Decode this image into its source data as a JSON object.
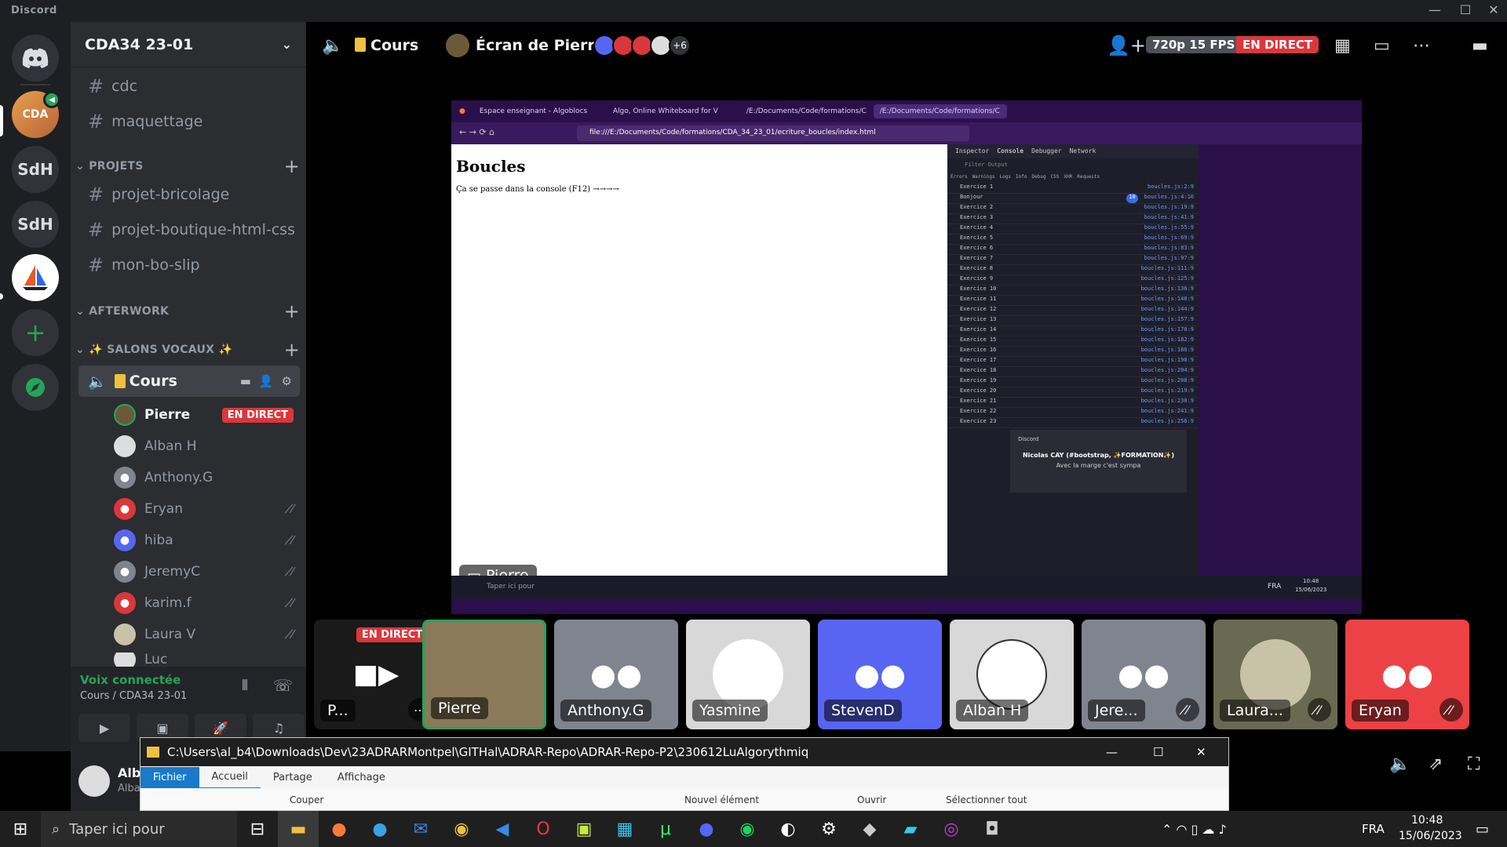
{
  "window": {
    "brand": "Discord"
  },
  "guilds": [
    {
      "label": "SdH"
    },
    {
      "label": "SdH"
    }
  ],
  "server": {
    "name": "CDA34 23-01"
  },
  "channels_top": [
    "cdc",
    "maquettage"
  ],
  "categories": {
    "projets": "PROJETS",
    "afterwork": "AFTERWORK",
    "vocaux": "✨ SALONS VOCAUX ✨"
  },
  "project_channels": [
    "projet-bricolage",
    "projet-boutique-html-css",
    "mon-bo-slip"
  ],
  "voice_channel": {
    "name": "Cours"
  },
  "members": [
    {
      "name": "Pierre",
      "live": "EN DIRECT"
    },
    {
      "name": "Alban H"
    },
    {
      "name": "Anthony.G"
    },
    {
      "name": "Eryan"
    },
    {
      "name": "hiba"
    },
    {
      "name": "JeremyC"
    },
    {
      "name": "karim.f"
    },
    {
      "name": "Laura V"
    },
    {
      "name": "Luc"
    }
  ],
  "voice_status": {
    "title": "Voix connectée",
    "sub": "Cours / CDA34 23-01"
  },
  "user": {
    "name": "Alb",
    "tag": "Alba"
  },
  "header": {
    "channel": "Cours",
    "stream_title": "Écran de Pierre",
    "extra_count": "+6",
    "quality": "720p 15 FPS",
    "live": "EN DIRECT"
  },
  "stream": {
    "tabs": [
      "Espace enseignant - Algoblocs",
      "Algo, Online Whiteboard for V",
      "/E:/Documents/Code/formations/C",
      "/E:/Documents/Code/formations/C"
    ],
    "url": "file:///E:/Documents/Code/formations/CDA_34_23_01/ecriture_boucles/index.html",
    "page_title": "Boucles",
    "page_text": "Ça se passe dans la console (F12) →→→→",
    "devtools_tabs": [
      "Inspector",
      "Console",
      "Debugger",
      "Network"
    ],
    "filter": "Filter Output",
    "filters": [
      "Errors",
      "Warnings",
      "Logs",
      "Info",
      "Debug",
      "CSS",
      "XHR",
      "Requests"
    ],
    "console_lines": [
      {
        "t": "Exercice 1",
        "s": "boucles.js:2:9"
      },
      {
        "t": "Bonjour",
        "s": "boucles.js:4:10",
        "badge": "10"
      },
      {
        "t": "Exercice 2",
        "s": "boucles.js:19:9"
      },
      {
        "t": "Exercice 3",
        "s": "boucles.js:41:9"
      },
      {
        "t": "Exercice 4",
        "s": "boucles.js:55:9"
      },
      {
        "t": "Exercice 5",
        "s": "boucles.js:69:9"
      },
      {
        "t": "Exercice 6",
        "s": "boucles.js:83:9"
      },
      {
        "t": "Exercice 7",
        "s": "boucles.js:97:9"
      },
      {
        "t": "Exercice 8",
        "s": "boucles.js:111:9"
      },
      {
        "t": "Exercice 9",
        "s": "boucles.js:125:9"
      },
      {
        "t": "Exercice 10",
        "s": "boucles.js:136:9"
      },
      {
        "t": "Exercice 11",
        "s": "boucles.js:140:9"
      },
      {
        "t": "Exercice 12",
        "s": "boucles.js:144:9"
      },
      {
        "t": "Exercice 13",
        "s": "boucles.js:157:9"
      },
      {
        "t": "Exercice 14",
        "s": "boucles.js:170:9"
      },
      {
        "t": "Exercice 15",
        "s": "boucles.js:182:9"
      },
      {
        "t": "Exercice 16",
        "s": "boucles.js:186:9"
      },
      {
        "t": "Exercice 17",
        "s": "boucles.js:190:9"
      },
      {
        "t": "Exercice 18",
        "s": "boucles.js:204:9"
      },
      {
        "t": "Exercice 19",
        "s": "boucles.js:208:9"
      },
      {
        "t": "Exercice 20",
        "s": "boucles.js:219:9"
      },
      {
        "t": "Exercice 21",
        "s": "boucles.js:230:9"
      },
      {
        "t": "Exercice 22",
        "s": "boucles.js:241:9"
      },
      {
        "t": "Exercice 23",
        "s": "boucles.js:256:9"
      }
    ],
    "toast": {
      "app": "Discord",
      "title": "Nicolas CAY (#bootstrap, ✨FORMATION✨)",
      "body": "Avec la marge c'est sympa"
    },
    "streamer_label": "Pierre",
    "inner_taskbar": {
      "search": "Taper ici pour",
      "lang": "FRA",
      "time": "10:48",
      "date": "15/06/2023"
    }
  },
  "tiles": [
    {
      "name": "P...",
      "live": "EN DIRECT"
    },
    {
      "name": "Pierre"
    },
    {
      "name": "Anthony.G"
    },
    {
      "name": "Yasmine"
    },
    {
      "name": "StevenD"
    },
    {
      "name": "Alban H"
    },
    {
      "name": "Jere..."
    },
    {
      "name": "Laura..."
    },
    {
      "name": "Eryan"
    }
  ],
  "explorer": {
    "path": "C:\\Users\\al_b4\\Downloads\\Dev\\23ADRARMontpel\\GITHal\\ADRAR-Repo\\ADRAR-Repo-P2\\230612LuAlgorythmiq",
    "tabs": [
      "Fichier",
      "Accueil",
      "Partage",
      "Affichage"
    ],
    "ribbon": [
      "Couper",
      "Nouvel élément",
      "Ouvrir",
      "Sélectionner tout"
    ]
  },
  "taskbar": {
    "search": "Taper ici pour",
    "lang": "FRA",
    "time": "10:48",
    "date": "15/06/2023"
  },
  "colors": {
    "blurple": "#5865f2",
    "red": "#da373c",
    "green": "#23a55a",
    "purple": "#4b2a7a"
  }
}
